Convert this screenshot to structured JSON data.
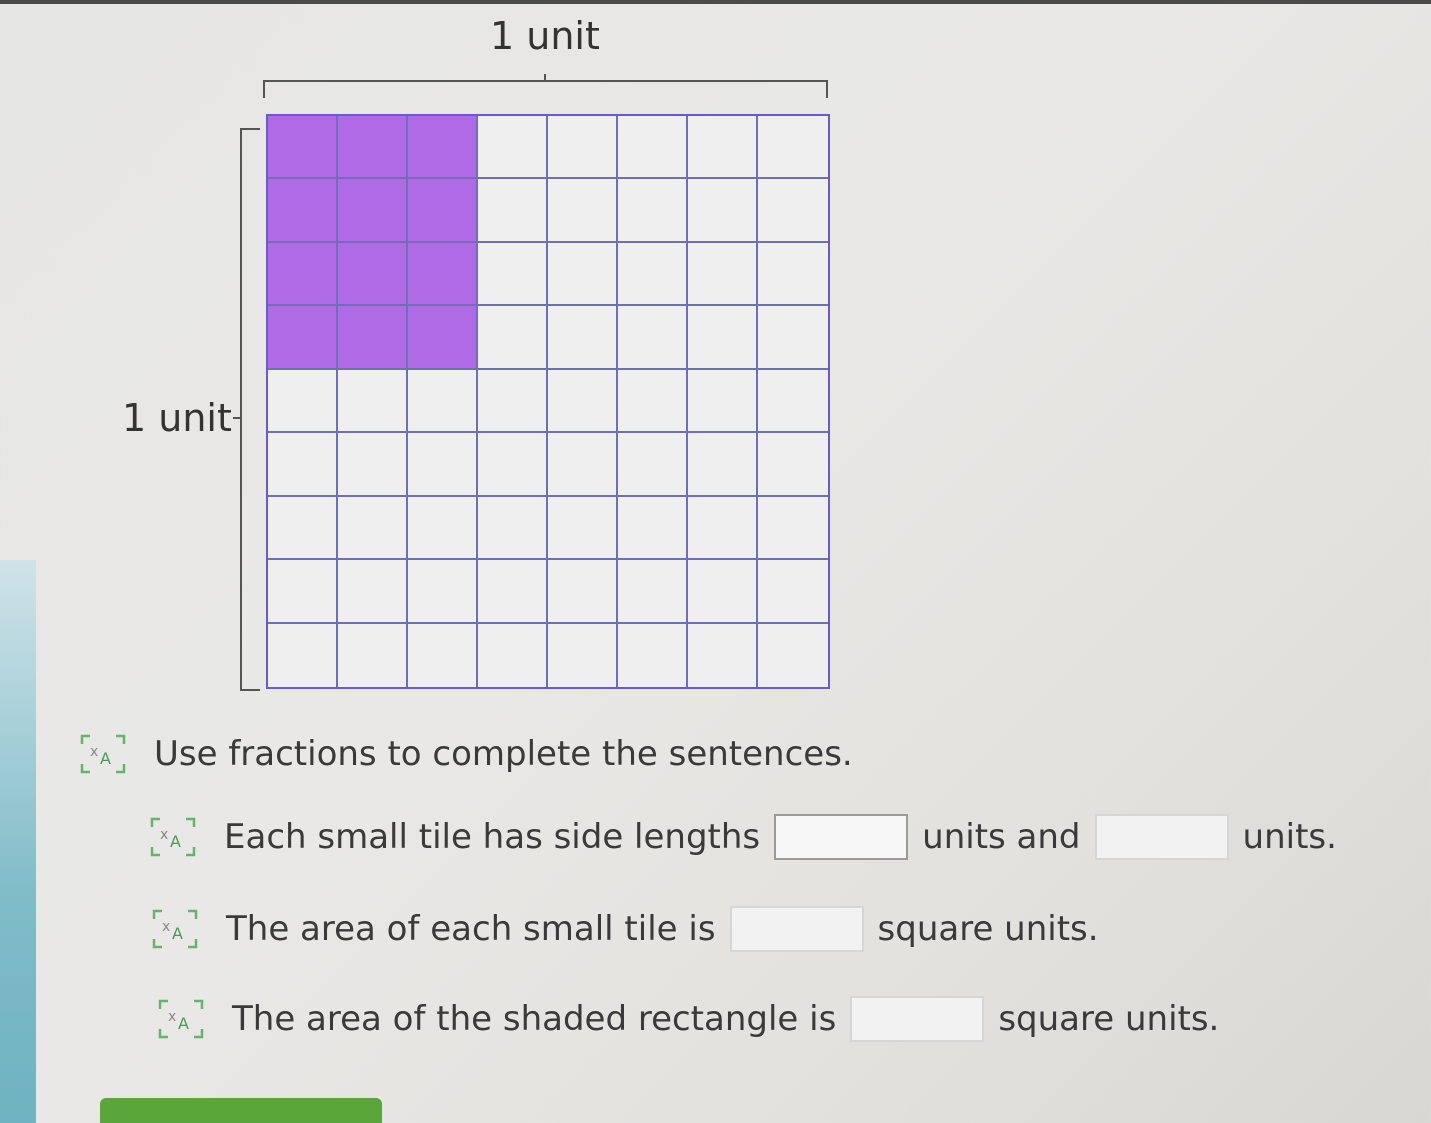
{
  "diagram": {
    "top_label": "1 unit",
    "side_label": "1 unit",
    "grid": {
      "columns": 8,
      "rows": 9,
      "shaded_columns": 3,
      "shaded_rows": 4
    },
    "shade_color": "#b16ae6",
    "line_color": "#6f6fb5"
  },
  "instruction": {
    "icon": "text-to-speech-icon",
    "text": "Use fractions to complete the sentences."
  },
  "questions": [
    {
      "icon": "text-to-speech-icon",
      "text_before": "Each small tile has side lengths",
      "text_middle": "units and",
      "text_after": "units."
    },
    {
      "icon": "text-to-speech-icon",
      "text_before": "The area of each small tile is",
      "text_after": "square units."
    },
    {
      "icon": "text-to-speech-icon",
      "text_before": "The area of the shaded rectangle is",
      "text_after": "square units."
    }
  ],
  "accent_color": "#5aa63a"
}
